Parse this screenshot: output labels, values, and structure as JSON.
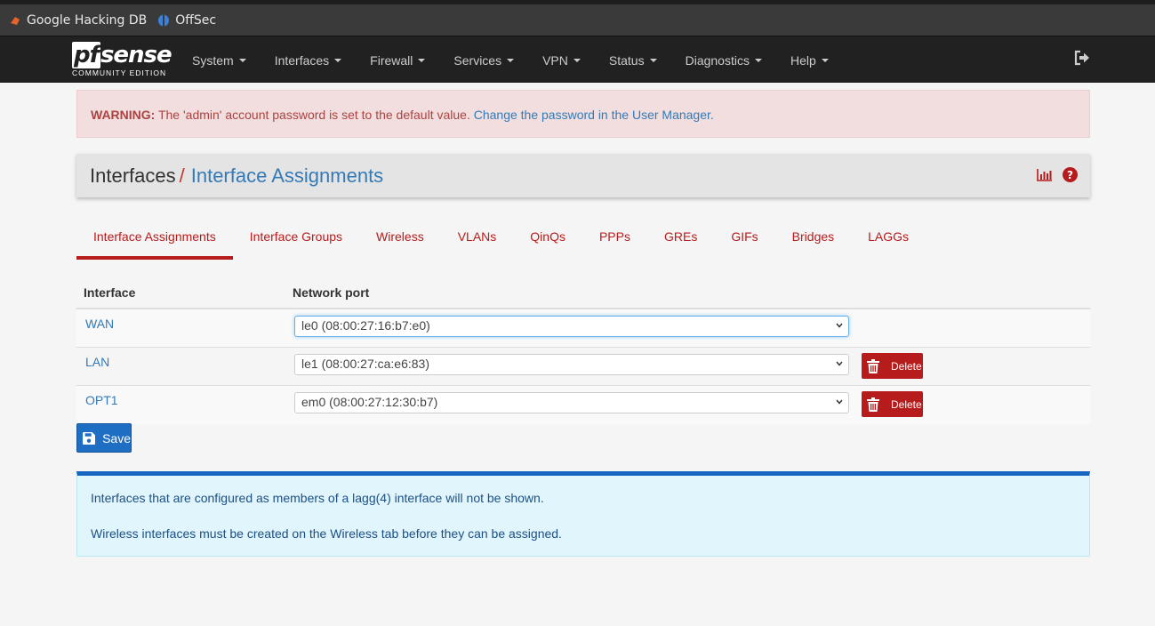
{
  "bookmarks": [
    {
      "label": "Google Hacking DB",
      "icon": "exploit-db-icon"
    },
    {
      "label": "OffSec",
      "icon": "offsec-icon"
    }
  ],
  "logo": {
    "main_pf": "pf",
    "main_rest": "sense",
    "sub": "COMMUNITY EDITION"
  },
  "nav": {
    "items": [
      "System",
      "Interfaces",
      "Firewall",
      "Services",
      "VPN",
      "Status",
      "Diagnostics",
      "Help"
    ]
  },
  "warning": {
    "strong": "WARNING:",
    "text": " The 'admin' account password is set to the default value. ",
    "link": "Change the password in the User Manager."
  },
  "breadcrumb": {
    "section": "Interfaces",
    "separator": "/",
    "page": "Interface Assignments"
  },
  "tabs": [
    "Interface Assignments",
    "Interface Groups",
    "Wireless",
    "VLANs",
    "QinQs",
    "PPPs",
    "GREs",
    "GIFs",
    "Bridges",
    "LAGGs"
  ],
  "active_tab": "Interface Assignments",
  "table": {
    "headers": {
      "interface": "Interface",
      "port": "Network port"
    },
    "rows": [
      {
        "interface": "WAN",
        "port": "le0 (08:00:27:16:b7:e0)",
        "delete": null
      },
      {
        "interface": "LAN",
        "port": "le1 (08:00:27:ca:e6:83)",
        "delete": "Delete"
      },
      {
        "interface": "OPT1",
        "port": "em0 (08:00:27:12:30:b7)",
        "delete": "Delete"
      }
    ]
  },
  "save_label": "Save",
  "info": {
    "line1": "Interfaces that are configured as members of a lagg(4) interface will not be shown.",
    "line2": "Wireless interfaces must be created on the Wireless tab before they can be assigned."
  },
  "colors": {
    "brand_red": "#b71c1c",
    "link_blue": "#337ab7",
    "save_blue": "#1e6fc4",
    "navbar": "#212121"
  }
}
